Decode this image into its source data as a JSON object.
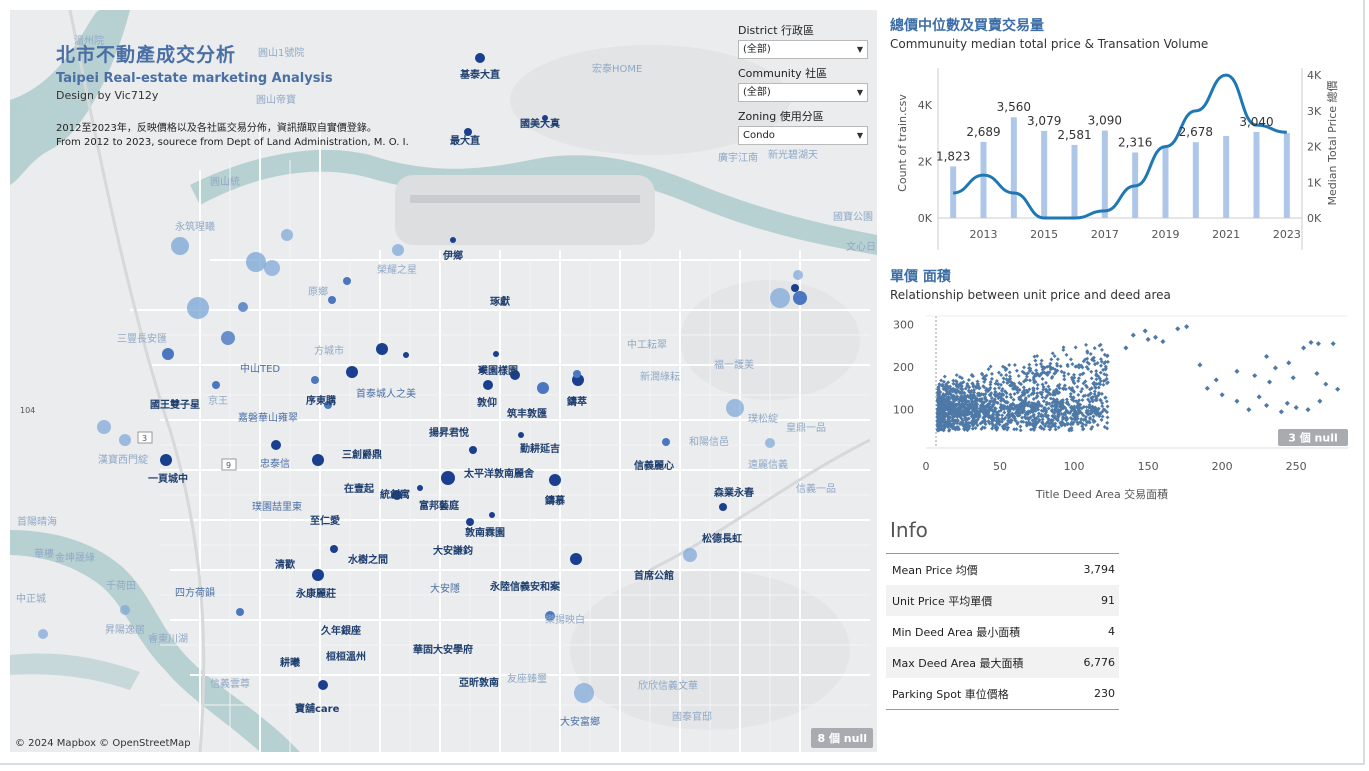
{
  "map": {
    "title_zh": "北市不動產成交分析",
    "title_en": "Taipei Real-estate marketing Analysis",
    "design_by": "Design by Vic712y",
    "desc_zh": "2012至2023年，反映價格以及各社區交易分佈，資訊擷取自實價登錄。",
    "desc_en": "From 2012 to 2023, sourece from Dept of Land Administration, M. O. I.",
    "attribution": "© 2024 Mapbox © OpenStreetMap",
    "null_badge": "8 個 null",
    "filters": [
      {
        "label": "District 行政區",
        "value": "(全部)"
      },
      {
        "label": "Community 社區",
        "value": "(全部)"
      },
      {
        "label": "Zoning 使用分區",
        "value": "Condo"
      }
    ],
    "places": [
      {
        "name": "基泰大直"
      },
      {
        "name": "最大直"
      },
      {
        "name": "國美大真"
      },
      {
        "name": "伊鄉"
      },
      {
        "name": "琢獻"
      },
      {
        "name": "璞園樣園"
      },
      {
        "name": "敦仰"
      },
      {
        "name": "鑄萃"
      },
      {
        "name": "筑丰敦匯"
      },
      {
        "name": "揚昇君悅"
      },
      {
        "name": "勤耕延吉"
      },
      {
        "name": "太平洋敦南麗舍"
      },
      {
        "name": "鑄慕"
      },
      {
        "name": "富邦藝庭"
      },
      {
        "name": "統創寓"
      },
      {
        "name": "在壹起"
      },
      {
        "name": "三創爵鼎"
      },
      {
        "name": "首泰城人之美"
      },
      {
        "name": "序東購"
      },
      {
        "name": "中山TED"
      },
      {
        "name": "國王雙子星"
      },
      {
        "name": "嘉磐華山雍翠"
      },
      {
        "name": "忠泰信"
      },
      {
        "name": "一頁城中"
      },
      {
        "name": "璞園喆里東"
      },
      {
        "name": "至仁愛"
      },
      {
        "name": "敦南霖園"
      },
      {
        "name": "大安謙鈞"
      },
      {
        "name": "水樹之間"
      },
      {
        "name": "清歡"
      },
      {
        "name": "永康麗莊"
      },
      {
        "name": "大安隱"
      },
      {
        "name": "永陸信義安和案"
      },
      {
        "name": "信義麗心"
      },
      {
        "name": "森業永春"
      },
      {
        "name": "松德長虹"
      },
      {
        "name": "首席公館"
      },
      {
        "name": "四方荷韻"
      },
      {
        "name": "久年銀座"
      },
      {
        "name": "桓桓溫州"
      },
      {
        "name": "華固大安學府"
      },
      {
        "name": "耕曦"
      },
      {
        "name": "亞昕敦南"
      },
      {
        "name": "寶舖care"
      },
      {
        "name": "大安富鄉"
      }
    ],
    "faint_places": [
      {
        "name": "溫州院"
      },
      {
        "name": "圓山1號院"
      },
      {
        "name": "圓山帝寶"
      },
      {
        "name": "宏泰HOME"
      },
      {
        "name": "廣宇江南"
      },
      {
        "name": "新光碧湖天"
      },
      {
        "name": "圓山統"
      },
      {
        "name": "永筑瑆曦"
      },
      {
        "name": "榮耀之星"
      },
      {
        "name": "原鄉"
      },
      {
        "name": "方城市"
      },
      {
        "name": "三豐長安匯"
      },
      {
        "name": "中工耘翠"
      },
      {
        "name": "福一護美"
      },
      {
        "name": "新潤綠耘"
      },
      {
        "name": "璞松綻"
      },
      {
        "name": "京王"
      },
      {
        "name": "和陽信邑"
      },
      {
        "name": "皇鼎一品"
      },
      {
        "name": "漢寶西門綻"
      },
      {
        "name": "遠麗信義"
      },
      {
        "name": "信義一品"
      },
      {
        "name": "首陽晴海"
      },
      {
        "name": "華樓"
      },
      {
        "name": "金坤晟綠"
      },
      {
        "name": "千荷田"
      },
      {
        "name": "中正城"
      },
      {
        "name": "昇陽逸居"
      },
      {
        "name": "睿東川湖"
      },
      {
        "name": "樂揚映白"
      },
      {
        "name": "友座臻璽"
      },
      {
        "name": "欣欣信義文華"
      },
      {
        "name": "國泰官邸"
      },
      {
        "name": "文心日"
      },
      {
        "name": "信義雲尊"
      },
      {
        "name": "國寶公園"
      }
    ]
  },
  "bar_chart": {
    "title": "總價中位數及買賣交易量",
    "subtitle": "Communuity median total price & Transation Volume",
    "y_left_label": "Count of train.csv",
    "y_right_label": "Median Total Price 總價",
    "y_left_ticks": [
      "4K",
      "2K",
      "0K"
    ],
    "y_right_ticks": [
      "4K",
      "3K",
      "2K",
      "1K",
      "0K"
    ],
    "x_ticks": [
      "2013",
      "2015",
      "2017",
      "2019",
      "2021",
      "2023"
    ]
  },
  "scatter_chart": {
    "title": "單價 面積",
    "subtitle": "Relationship between unit price and deed area",
    "xlabel": "Title Deed Area 交易面積",
    "x_ticks": [
      "0",
      "50",
      "100",
      "150",
      "200",
      "250"
    ],
    "y_ticks": [
      "300",
      "200",
      "100"
    ],
    "null_badge": "3 個 null"
  },
  "chart_data": [
    {
      "type": "bar",
      "title": "總價中位數及買賣交易量",
      "categories": [
        "2012",
        "2013",
        "2014",
        "2015",
        "2016",
        "2017",
        "2018",
        "2019",
        "2020",
        "2021",
        "2022",
        "2023"
      ],
      "series": [
        {
          "name": "Count of train.csv",
          "type": "bar",
          "values": [
            1823,
            2689,
            3560,
            3079,
            2581,
            3090,
            2316,
            2500,
            2678,
            2900,
            3040,
            3000
          ]
        },
        {
          "name": "Median Total Price 總價",
          "type": "line",
          "values": [
            700,
            1200,
            700,
            0,
            0,
            200,
            900,
            2000,
            3000,
            4000,
            2600,
            2400
          ]
        }
      ],
      "data_labels": [
        {
          "category": "2012",
          "text": "1,823"
        },
        {
          "category": "2013",
          "text": "2,689"
        },
        {
          "category": "2014",
          "text": "3,560"
        },
        {
          "category": "2015",
          "text": "3,079"
        },
        {
          "category": "2016",
          "text": "2,581"
        },
        {
          "category": "2017",
          "text": "3,090"
        },
        {
          "category": "2018",
          "text": "2,316"
        },
        {
          "category": "2020",
          "text": "2,678"
        },
        {
          "category": "2022",
          "text": "3,040"
        }
      ],
      "ylim_left": [
        0,
        5300
      ],
      "ylim_right": [
        0,
        4200
      ],
      "bar_color": "#aec7e8",
      "line_color": "#1f77b4"
    },
    {
      "type": "scatter",
      "title": "單價 面積",
      "xlabel": "Title Deed Area 交易面積",
      "ylabel": "",
      "xlim": [
        0,
        285
      ],
      "ylim": [
        10,
        320
      ],
      "point_color": "#4e79a7",
      "points_summary": "dense cluster x 5-120, y 50-260; sparse tail to x 280, y up to 295",
      "sample_points": [
        [
          170,
          290
        ],
        [
          176,
          295
        ],
        [
          148,
          285
        ],
        [
          160,
          260
        ],
        [
          155,
          270
        ],
        [
          140,
          275
        ],
        [
          150,
          265
        ],
        [
          135,
          245
        ],
        [
          275,
          255
        ],
        [
          265,
          255
        ],
        [
          255,
          245
        ],
        [
          260,
          258
        ],
        [
          230,
          225
        ],
        [
          245,
          210
        ],
        [
          236,
          198
        ],
        [
          210,
          190
        ],
        [
          222,
          180
        ],
        [
          248,
          175
        ],
        [
          264,
          185
        ],
        [
          270,
          160
        ],
        [
          278,
          148
        ],
        [
          232,
          165
        ],
        [
          196,
          170
        ],
        [
          185,
          205
        ],
        [
          190,
          150
        ],
        [
          200,
          135
        ],
        [
          210,
          120
        ],
        [
          218,
          100
        ],
        [
          230,
          110
        ],
        [
          240,
          95
        ],
        [
          250,
          105
        ],
        [
          258,
          100
        ],
        [
          266,
          120
        ],
        [
          244,
          115
        ],
        [
          225,
          130
        ]
      ]
    }
  ],
  "info": {
    "title": "Info",
    "rows": [
      {
        "label": "Mean Price 均價",
        "value": "3,794"
      },
      {
        "label": "Unit Price  平均單價",
        "value": "91"
      },
      {
        "label": "Min Deed Area 最小面積",
        "value": "4"
      },
      {
        "label": "Max Deed Area 最大面積",
        "value": "6,776"
      },
      {
        "label": "Parking Spot  車位價格",
        "value": "230"
      }
    ]
  },
  "colors": {
    "accent": "#3d6ea8",
    "map_bg": "#eaecee",
    "river": "#b7d1d2",
    "dot_dark": "#1a3f8f",
    "dot_light": "#7aa5d6"
  }
}
